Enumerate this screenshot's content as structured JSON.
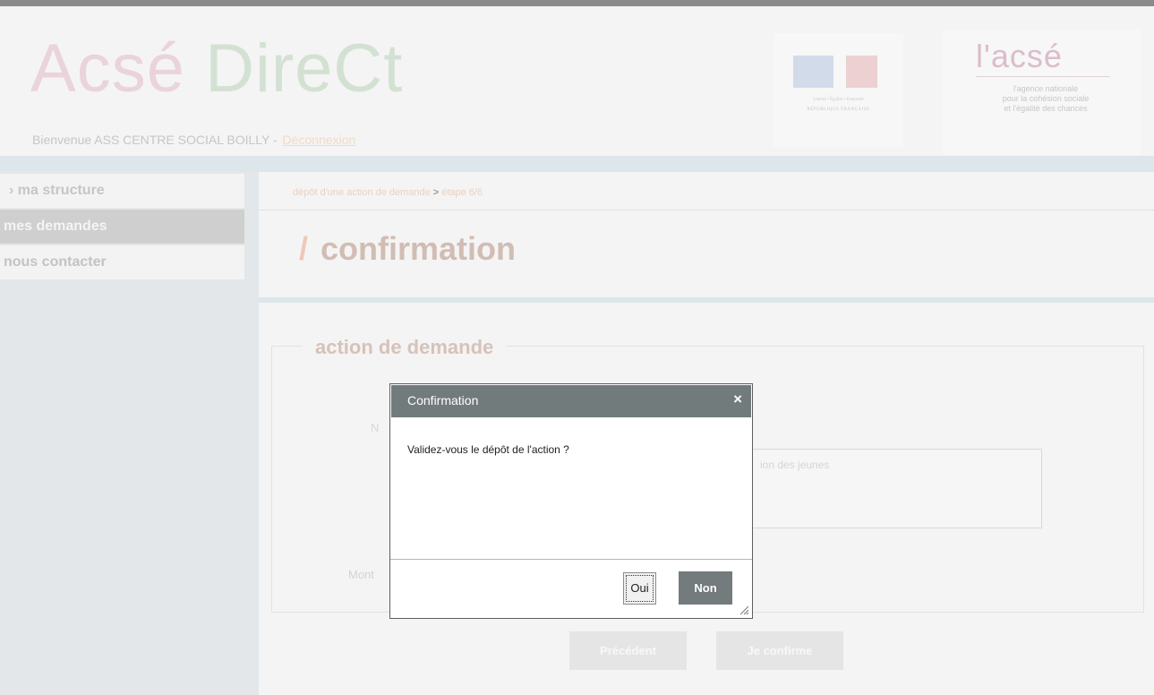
{
  "header": {
    "logo": {
      "part1": "Acsé ",
      "part2": "DireCt"
    },
    "welcome": "Bienvenue ASS CENTRE SOCIAL BOILLY - ",
    "logout_label": "Déconnexion",
    "republique": {
      "motto": "Liberté • Égalité • Fraternité",
      "name": "RÉPUBLIQUE FRANÇAISE"
    },
    "acse": {
      "logo": "l'acsé",
      "tagline1": "l'agence nationale",
      "tagline2": "pour la cohésion sociale",
      "tagline3": "et l'égalité des chances"
    }
  },
  "sidebar": {
    "items": [
      {
        "label": "› ma structure"
      },
      {
        "label": "mes demandes"
      },
      {
        "label": "nous contacter"
      }
    ]
  },
  "main": {
    "breadcrumb": {
      "part1": "dépôt d'une action de demande",
      "separator": ">",
      "part2": "étape 6/6"
    },
    "title_slash": "/",
    "title": "confirmation",
    "section_title": "action de demande",
    "bg_label_n": "N",
    "bg_textarea_text": "ion des jeunes",
    "bg_label_mont": "Mont",
    "prev_button": "Précédent",
    "confirm_button": "Je confirme"
  },
  "dialog": {
    "title": "Confirmation",
    "close_label": "×",
    "message": "Validez-vous le dépôt de l'action ?",
    "yes_label": "Oui",
    "no_label": "Non"
  },
  "colors": {
    "dialog_title_bg": "#727b7c",
    "button_dark": "#737b7c",
    "overlay_bg": "#f4f4f4"
  }
}
